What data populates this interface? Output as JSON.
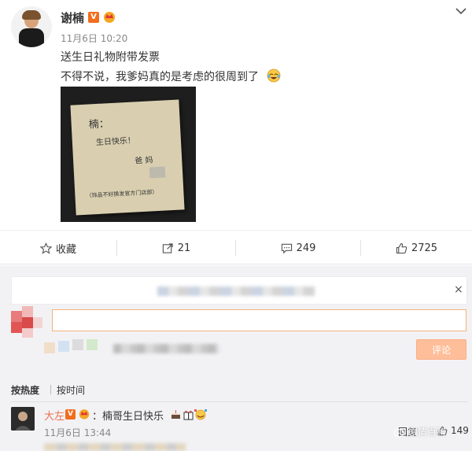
{
  "post": {
    "username": "谢楠",
    "verified_badge": "V",
    "time": "11月6日 10:20",
    "text_line1": "送生日礼物附带发票",
    "text_line2": "不得不说，我爹妈真的是考虑的很周到了",
    "photo_note_lines": [
      "楠：",
      "生日快乐！",
      "爸 妈",
      "（饰品不好换发官方门店部）"
    ]
  },
  "actions": {
    "favorite_label": "收藏",
    "repost_count": "21",
    "comment_count": "249",
    "like_count": "2725"
  },
  "composer": {
    "close_glyph": "×",
    "submit_label": "评论"
  },
  "sort": {
    "hot_label": "按热度",
    "time_label": "按时间"
  },
  "comment": {
    "username": "大左",
    "verified_badge": "V",
    "text": "：楠哥生日快乐",
    "date": "11月6日 13:44",
    "reply_label": "回复",
    "like_count": "149"
  },
  "watermark": {
    "text": "剧情百科"
  },
  "colors": {
    "accent_orange": "#f26d1e",
    "username_link": "#eb7350",
    "submit_button": "#ffbe9a",
    "comment_bg": "#f2f2f5"
  }
}
